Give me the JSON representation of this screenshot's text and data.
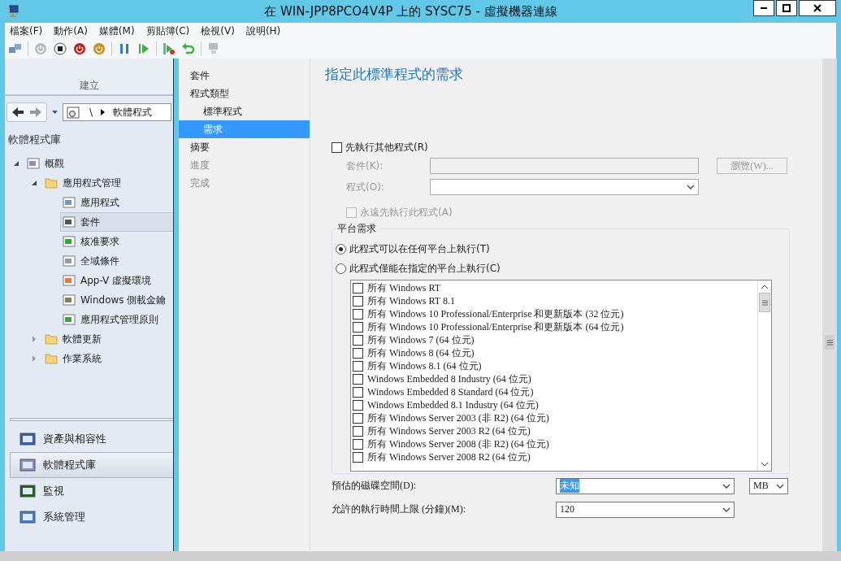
{
  "window": {
    "title": "在 WIN-JPP8PCO4V4P 上的 SYSC75 - 虛擬機器連線"
  },
  "menu": [
    "檔案(F)",
    "動作(A)",
    "媒體(M)",
    "剪貼簿(C)",
    "檢視(V)",
    "說明(H)"
  ],
  "ribbon": {
    "group_label": "建立"
  },
  "breadcrumb": {
    "separator": "\\",
    "location": "軟體程式"
  },
  "navigation": {
    "title": "軟體程式庫",
    "tree": [
      {
        "label": "概觀",
        "expanded": true,
        "selected": false,
        "children": [
          {
            "label": "應用程式管理",
            "expanded": true,
            "selected": false,
            "children": [
              {
                "label": "應用程式",
                "selected": false
              },
              {
                "label": "套件",
                "selected": true
              },
              {
                "label": "核准要求",
                "selected": false
              },
              {
                "label": "全域條件",
                "selected": false
              },
              {
                "label": "App-V 虛擬環境",
                "selected": false
              },
              {
                "label": "Windows 側載金鑰",
                "selected": false
              },
              {
                "label": "應用程式管理原則",
                "selected": false
              }
            ]
          },
          {
            "label": "軟體更新",
            "expanded": false,
            "selected": false
          },
          {
            "label": "作業系統",
            "expanded": false,
            "selected": false
          }
        ]
      }
    ]
  },
  "workspaces": [
    {
      "label": "資產與相容性",
      "selected": false
    },
    {
      "label": "軟體程式庫",
      "selected": true
    },
    {
      "label": "監視",
      "selected": false
    },
    {
      "label": "系統管理",
      "selected": false
    }
  ],
  "wizard_steps": [
    {
      "label": "套件",
      "disabled": false,
      "selected": false
    },
    {
      "label": "程式類型",
      "disabled": false,
      "selected": false,
      "children": [
        {
          "label": "標準程式",
          "disabled": false,
          "selected": false
        },
        {
          "label": "需求",
          "disabled": false,
          "selected": true
        }
      ]
    },
    {
      "label": "摘要",
      "disabled": false,
      "selected": false
    },
    {
      "label": "進度",
      "disabled": true,
      "selected": false
    },
    {
      "label": "完成",
      "disabled": true,
      "selected": false
    }
  ],
  "page_title": "指定此標準程式的需求",
  "run_another": {
    "label": "先執行其他程式(R)",
    "checked": false
  },
  "package_field": {
    "label": "套件(K):",
    "disabled": true
  },
  "program_field": {
    "label": "程式(O):",
    "disabled": true
  },
  "browse_button": {
    "label": "瀏覽(W)...",
    "disabled": true
  },
  "always_run": {
    "label": "永遠先執行此程式(A)",
    "checked": false,
    "disabled": true
  },
  "platform": {
    "title": "平台需求",
    "options": [
      {
        "label": "此程式可以在任何平台上執行(T)",
        "selected": true
      },
      {
        "label": "此程式僅能在指定的平台上執行(C)",
        "selected": false
      }
    ],
    "platforms": [
      {
        "label": "所有 Windows RT",
        "checked": false
      },
      {
        "label": "所有 Windows RT 8.1",
        "checked": false
      },
      {
        "label": "所有 Windows 10 Professional/Enterprise 和更新版本 (32 位元)",
        "checked": false
      },
      {
        "label": "所有 Windows 10 Professional/Enterprise 和更新版本 (64 位元)",
        "checked": false
      },
      {
        "label": "所有 Windows 7 (64 位元)",
        "checked": false
      },
      {
        "label": "所有 Windows 8 (64 位元)",
        "checked": false
      },
      {
        "label": "所有 Windows 8.1 (64 位元)",
        "checked": false
      },
      {
        "label": "Windows Embedded 8 Industry (64 位元)",
        "checked": false
      },
      {
        "label": "Windows Embedded 8 Standard (64 位元)",
        "checked": false
      },
      {
        "label": "Windows Embedded 8.1 Industry (64 位元)",
        "checked": false
      },
      {
        "label": "所有 Windows Server 2003 (非 R2) (64 位元)",
        "checked": false
      },
      {
        "label": "所有 Windows Server 2003 R2 (64 位元)",
        "checked": false
      },
      {
        "label": "所有 Windows Server 2008 (非 R2) (64 位元)",
        "checked": false
      },
      {
        "label": "所有 Windows Server 2008 R2 (64 位元)",
        "checked": false
      }
    ]
  },
  "disk_space": {
    "label": "預估的磁碟空間(D):",
    "value": "未知",
    "unit": "MB"
  },
  "max_runtime": {
    "label": "允許的執行時間上限 (分鐘)(M):",
    "value": "120"
  }
}
